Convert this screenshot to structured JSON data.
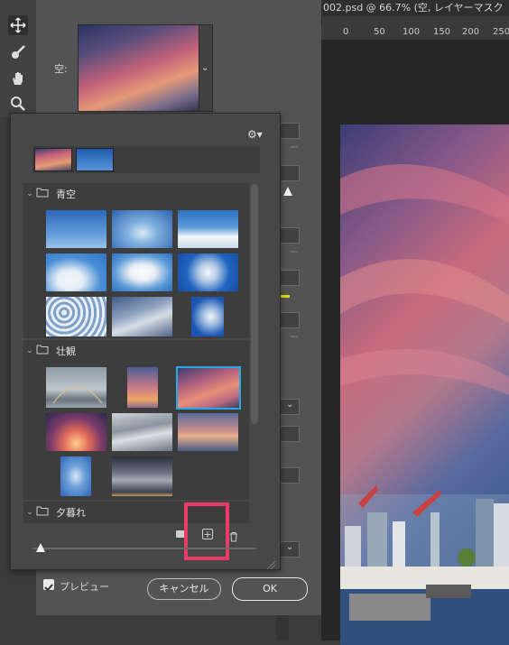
{
  "document_title": "002.psd @ 66.7% (空, レイヤーマスク",
  "ruler_labels": [
    "0",
    "50",
    "100",
    "150",
    "200",
    "250"
  ],
  "sky_label": "空:",
  "groups": [
    {
      "name": "青空"
    },
    {
      "name": "壮観"
    },
    {
      "name": "夕暮れ"
    }
  ],
  "preview_label": "プレビュー",
  "preview_checked": true,
  "cancel_label": "キャンセル",
  "ok_label": "OK",
  "colors": {
    "highlight_box": "#ec3a6b",
    "selected_border": "#29a7e8",
    "accent_yellow": "#e0d81a"
  }
}
